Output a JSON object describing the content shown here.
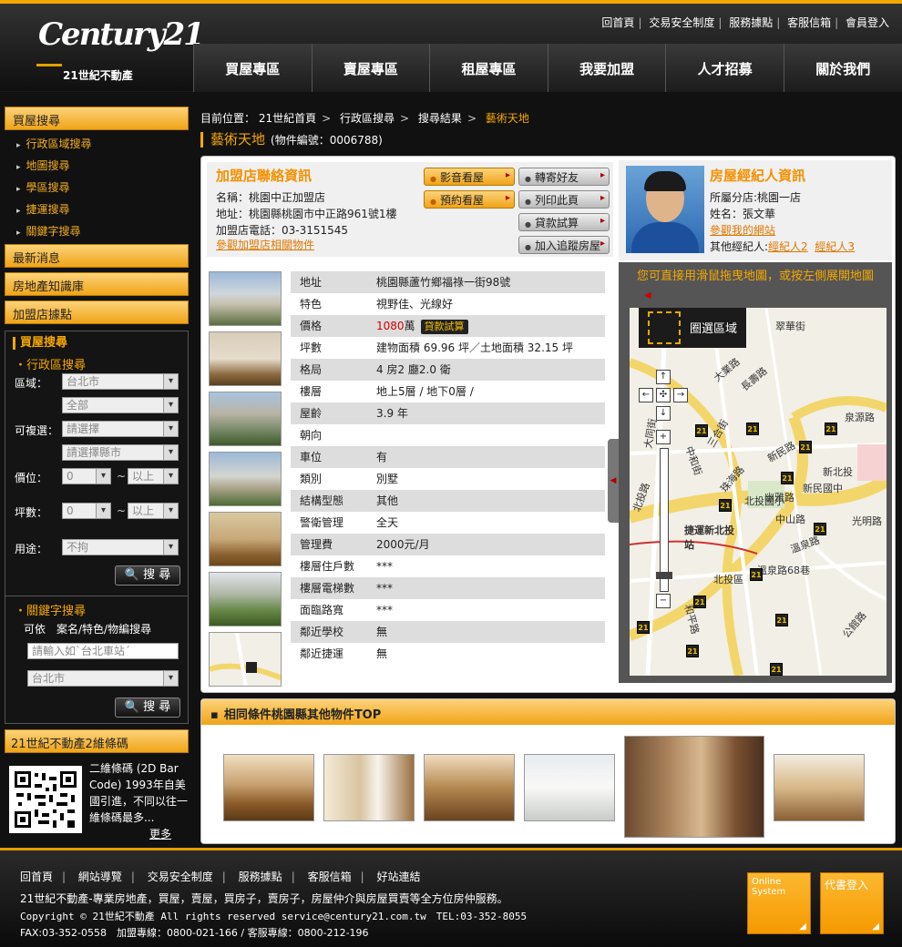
{
  "header": {
    "logo_text": "Century21",
    "logo_sub": "21世紀不動產",
    "top_links": [
      "回首頁",
      "交易安全制度",
      "服務據點",
      "客服信箱",
      "會員登入"
    ],
    "nav": [
      "買屋專區",
      "賣屋專區",
      "租屋專區",
      "我要加盟",
      "人才招募",
      "關於我們"
    ]
  },
  "sidebar": {
    "buy_search": "買屋搜尋",
    "sub_items": [
      "行政區域搜尋",
      "地圖搜尋",
      "學區搜尋",
      "捷運搜尋",
      "關鍵字搜尋"
    ],
    "news": "最新消息",
    "knowledge": "房地產知識庫",
    "stores": "加盟店據點",
    "search": {
      "title": "買屋搜尋",
      "district_title": "・行政區搜尋",
      "area_label": "區域：",
      "area_value": "台北市",
      "area_sub": "全部",
      "multi_label": "可複選：",
      "multi_1": "請選擇",
      "multi_2": "請選擇縣市",
      "price_label": "價位：",
      "price_min": "0",
      "price_max": "以上",
      "tilde": "~",
      "ping_label": "坪數：",
      "ping_min": "0",
      "ping_max": "以上",
      "use_label": "用途：",
      "use_value": "不拘",
      "search_btn": "搜 尋",
      "keyword_title": "・關鍵字搜尋",
      "keyword_hint": "可依　案名/特色/物編搜尋",
      "keyword_placeholder": "請輸入如`台北車站´",
      "keyword_city": "台北市",
      "search_btn2": "搜 尋"
    },
    "qr_title": "21世紀不動產2維條碼",
    "qr_text": "二維條碼 (2D Bar Code) 1993年自美國引進，不同以往一維條碼最多...",
    "qr_more": "更多"
  },
  "main": {
    "breadcrumb": [
      "目前位置：",
      "21世紀首頁",
      "行政區搜尋",
      "搜尋結果",
      "藝術天地"
    ],
    "title": "藝術天地",
    "code": "(物件編號：0006788)",
    "store": {
      "title": "加盟店聯絡資訊",
      "name": "名稱：桃園中正加盟店",
      "address": "地址：桃園縣桃園市中正路961號1樓",
      "phone": "加盟店電話：03-3151545",
      "link": "參觀加盟店相關物件"
    },
    "buttons_orange": [
      "影音看屋",
      "預約看屋"
    ],
    "buttons_gray": [
      "轉寄好友",
      "列印此頁",
      "貸款試算",
      "加入追蹤房屋"
    ],
    "agent": {
      "title": "房屋經紀人資訊",
      "branch": "所屬分店:桃園一店",
      "name": "姓名：張文華",
      "site": "參觀我的網站",
      "others_label": "其他經紀人:",
      "other1": "經紀人2",
      "other2": "經紀人3"
    },
    "details": [
      {
        "k": "地址",
        "v": "桃園縣蘆竹鄉福祿一街98號"
      },
      {
        "k": "特色",
        "v": "視野佳、光線好"
      },
      {
        "k": "價格",
        "v": "萬"
      },
      {
        "k": "坪數",
        "v": "建物面積 69.96 坪／土地面積 32.15 坪"
      },
      {
        "k": "格局",
        "v": "4 房2 廳2.0 衛"
      },
      {
        "k": "樓層",
        "v": "地上5層 / 地下0層 /"
      },
      {
        "k": "屋齡",
        "v": "3.9 年"
      },
      {
        "k": "朝向",
        "v": ""
      },
      {
        "k": "車位",
        "v": "有"
      },
      {
        "k": "類別",
        "v": "別墅"
      },
      {
        "k": "結構型態",
        "v": "其他"
      },
      {
        "k": "警衛管理",
        "v": "全天"
      },
      {
        "k": "管理費",
        "v": "2000元/月"
      },
      {
        "k": "樓層住戶數",
        "v": "***"
      },
      {
        "k": "樓層電梯數",
        "v": "***"
      },
      {
        "k": "面臨路寬",
        "v": "***"
      },
      {
        "k": "鄰近學校",
        "v": "無"
      },
      {
        "k": "鄰近捷運",
        "v": "無"
      }
    ],
    "price_number": "1080",
    "loan_chip": "貸款試算",
    "map": {
      "hint": "您可直接用滑鼠拖曳地圖，或按左側展開地圖",
      "area_btn": "圈選區域",
      "labels": [
        "翠華街",
        "長壽路",
        "泉源路",
        "新北投",
        "中山路",
        "光明路",
        "溫泉路",
        "溫泉路68巷",
        "北投國小",
        "捷運新北投站",
        "新民國中",
        "新民路",
        "大同街",
        "北投路",
        "中和街",
        "珠海路",
        "幽雅路",
        "公館路",
        "和平路",
        "大業路",
        "三合街",
        "北投區"
      ]
    },
    "similar_title": "相同條件桃園縣其他物件TOP"
  },
  "footer": {
    "links": [
      "回首頁",
      "網站導覽",
      "交易安全制度",
      "服務據點",
      "客服信箱",
      "好站連結"
    ],
    "line1": "21世紀不動產-專業房地產，買屋，賣屋，買房子，賣房子，房屋仲介與房屋買賣等全方位房仲服務。",
    "line2": "Copyright © 21世紀不動產 All rights reserved service@century21.com.tw　TEL:03-352-8055",
    "line3": "FAX:03-352-0558　加盟專線：0800-021-166 / 客服專線：0800-212-196",
    "box1": "Online System",
    "box2": "代書登入"
  },
  "colors": {
    "accent": "#f5a800",
    "background": "#111111",
    "link": "#e07800",
    "price": "#d00000"
  }
}
